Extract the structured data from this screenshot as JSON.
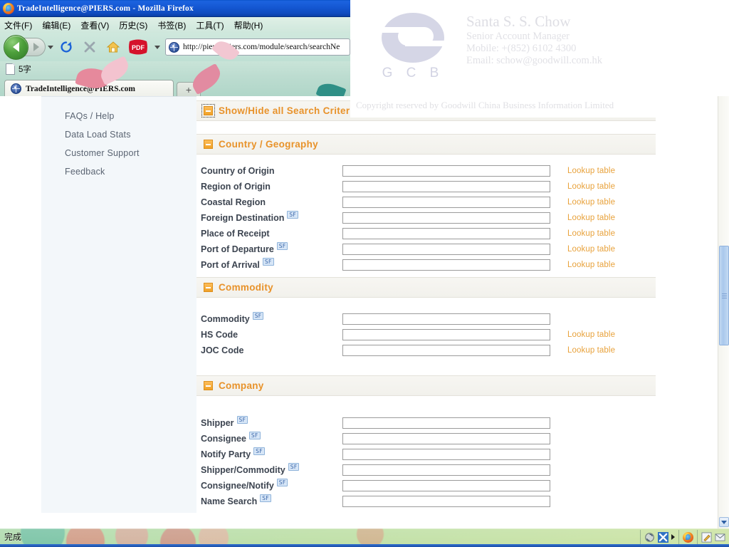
{
  "window": {
    "title": "TradeIntelligence@PIERS.com - Mozilla Firefox",
    "app_icon": "firefox-icon"
  },
  "menubar": {
    "items": [
      {
        "label": "文件(F)"
      },
      {
        "label": "编辑(E)"
      },
      {
        "label": "查看(V)"
      },
      {
        "label": "历史(S)"
      },
      {
        "label": "书签(B)"
      },
      {
        "label": "工具(T)"
      },
      {
        "label": "帮助(H)"
      }
    ]
  },
  "navbar": {
    "back": "back-icon",
    "forward": "forward-icon",
    "history_dropdown": "chevron-down-icon",
    "reload": "reload-icon",
    "stop": "stop-icon",
    "home": "home-icon",
    "pdf": "PDF",
    "url": "http://piersti.piers.com/module/search/searchNe"
  },
  "bookmarks": {
    "items": [
      {
        "label": "5字",
        "icon": "document-icon"
      }
    ]
  },
  "tabs": {
    "active": {
      "label": "TradeIntelligence@PIERS.com",
      "icon": "globe-icon"
    },
    "new_tab_label": "+"
  },
  "sidebar": {
    "items": [
      {
        "label": "FAQs / Help"
      },
      {
        "label": "Data Load Stats"
      },
      {
        "label": "Customer Support"
      },
      {
        "label": "Feedback"
      }
    ]
  },
  "content": {
    "toggle_all": {
      "label": "Show/Hide all Search Criteria",
      "icon": "minus-box-icon"
    },
    "lookup_label": "Lookup table",
    "sections": [
      {
        "title": "Country / Geography",
        "icon": "minus-box-icon",
        "fields": [
          {
            "label": "Country of Origin",
            "sf": false,
            "value": "",
            "lookup": true
          },
          {
            "label": "Region of Origin",
            "sf": false,
            "value": "",
            "lookup": true
          },
          {
            "label": "Coastal Region",
            "sf": false,
            "value": "",
            "lookup": true
          },
          {
            "label": "Foreign Destination",
            "sf": true,
            "value": "",
            "lookup": true
          },
          {
            "label": "Place of Receipt",
            "sf": false,
            "value": "",
            "lookup": true
          },
          {
            "label": "Port of Departure",
            "sf": true,
            "value": "",
            "lookup": true
          },
          {
            "label": "Port of Arrival",
            "sf": true,
            "value": "",
            "lookup": true
          }
        ]
      },
      {
        "title": "Commodity",
        "icon": "minus-box-icon",
        "fields": [
          {
            "label": "Commodity",
            "sf": true,
            "value": "",
            "lookup": false
          },
          {
            "label": "HS Code",
            "sf": false,
            "value": "",
            "lookup": true
          },
          {
            "label": "JOC Code",
            "sf": false,
            "value": "",
            "lookup": true
          }
        ]
      },
      {
        "title": "Company",
        "icon": "minus-box-icon",
        "fields": [
          {
            "label": "Shipper",
            "sf": true,
            "value": "",
            "lookup": false
          },
          {
            "label": "Consignee",
            "sf": true,
            "value": "",
            "lookup": false
          },
          {
            "label": "Notify Party",
            "sf": true,
            "value": "",
            "lookup": false
          },
          {
            "label": "Shipper/Commodity",
            "sf": true,
            "value": "",
            "lookup": false
          },
          {
            "label": "Consignee/Notify",
            "sf": true,
            "value": "",
            "lookup": false
          },
          {
            "label": "Name Search",
            "sf": true,
            "value": "",
            "lookup": false
          }
        ]
      }
    ],
    "sf_badge_label": "SF"
  },
  "watermark": {
    "logo_letters": "G C B",
    "name": "Santa S. S. Chow",
    "lines": [
      "Senior Account Manager",
      "Mobile: +(852) 6102 4300",
      "Email: schow@goodwill.com.hk"
    ],
    "copyright": "Copyright reserved by Goodwill China Business Information Limited"
  },
  "statusbar": {
    "text": "完成",
    "tray_icons": [
      "sync-icon",
      "scissors-icon",
      "tray-overflow-arrow-icon",
      "firefox-icon",
      "edit-pencil-icon",
      "mail-envelope-icon"
    ]
  },
  "scrollbar": {
    "down_arrow": "chevron-down-icon"
  },
  "colors": {
    "accent_orange": "#e8922a",
    "lookup_orange": "#e8a23c",
    "label_gray": "#3c4450",
    "sidebar_bg": "#f3f7fa",
    "titlebar_blue": "#1457d2"
  }
}
